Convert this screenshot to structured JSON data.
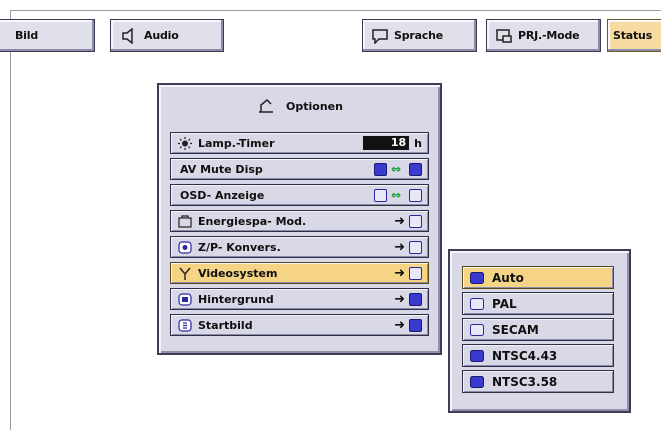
{
  "toolbar": {
    "bild": "Bild",
    "audio": "Audio",
    "sprache": "Sprache",
    "prj_mode": "PRJ.-Mode",
    "status": "Status"
  },
  "optionen": {
    "title": "Optionen",
    "rows": [
      {
        "label": "Lamp.-Timer",
        "value": "18",
        "unit": "h"
      },
      {
        "label": "AV Mute Disp"
      },
      {
        "label": "OSD- Anzeige"
      },
      {
        "label": "Energiespa- Mod."
      },
      {
        "label": "Z/P- Konvers."
      },
      {
        "label": "Videosystem"
      },
      {
        "label": "Hintergrund"
      },
      {
        "label": "Startbild"
      }
    ],
    "selected_row": "Videosystem"
  },
  "videosystem_menu": {
    "options": [
      "Auto",
      "PAL",
      "SECAM",
      "NTSC4.43",
      "NTSC3.58"
    ],
    "selected": "Auto"
  },
  "colors": {
    "panel": "#d8d8e6",
    "highlight": "#f6d486",
    "border": "#3d3d58",
    "icon_blue": "#3a3ad0"
  }
}
